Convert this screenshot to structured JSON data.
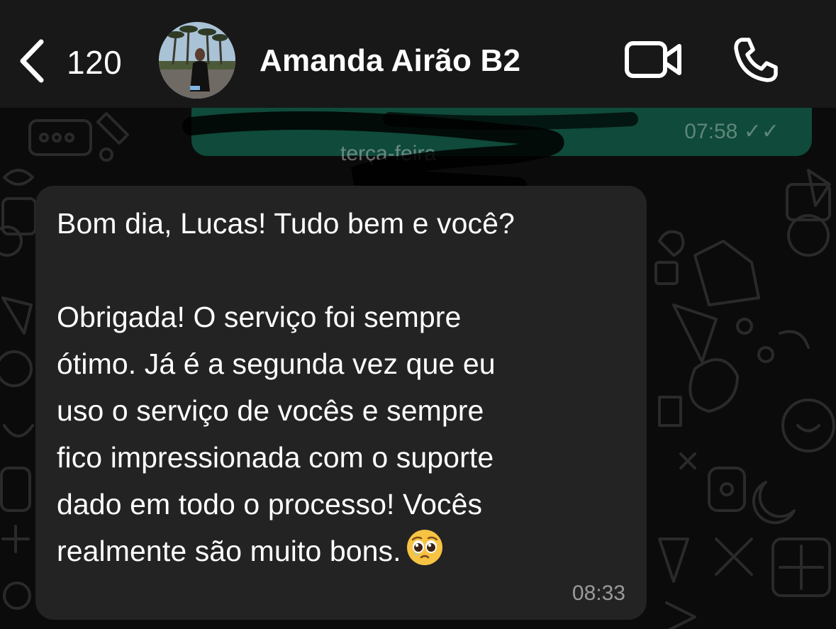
{
  "header": {
    "back_count": "120",
    "contact_name": "Amanda Airão B2",
    "icons": {
      "back": "chevron-left-icon",
      "video": "video-camera-icon",
      "call": "phone-icon"
    }
  },
  "previous_message": {
    "time": "07:58",
    "status": "double-check-icon",
    "date_separator": "terça-feira"
  },
  "message": {
    "lines": [
      "Bom dia, Lucas! Tudo bem e você?",
      "",
      "Obrigada! O serviço foi sempre",
      "ótimo. Já é a segunda vez que eu",
      "uso o serviço de vocês e sempre",
      "fico impressionada com o suporte",
      "dado em todo o processo! Vocês",
      "realmente são muito bons."
    ],
    "emoji": "pleading-face-icon",
    "time": "08:33"
  },
  "colors": {
    "header_bg": "#181818",
    "incoming_bubble": "#232323",
    "outgoing_bubble": "#0f4a3a",
    "wallpaper_bg": "#0b0b0b"
  }
}
